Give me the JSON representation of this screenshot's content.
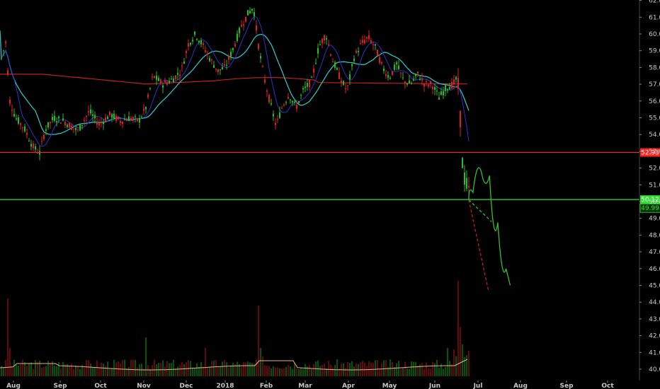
{
  "chart_data": {
    "type": "candlestick",
    "price_axis": {
      "ylim": [
        39.5,
        62.2
      ],
      "ticks": [
        "40.00",
        "41.00",
        "42.00",
        "43.00",
        "44.00",
        "45.00",
        "46.00",
        "47.00",
        "48.00",
        "49.00",
        "50.00",
        "51.00",
        "52.00",
        "53.00",
        "54.00",
        "55.00",
        "56.00",
        "57.00",
        "58.00",
        "59.00",
        "60.00",
        "61.00",
        "62.00"
      ]
    },
    "x_axis": {
      "labels": [
        "Aug",
        "Sep",
        "Oct",
        "Nov",
        "Dec",
        "2018",
        "Feb",
        "Mar",
        "Apr",
        "May",
        "Jun",
        "Jul",
        "Aug",
        "Sep",
        "Oct"
      ],
      "bold_labels": [
        "2018"
      ]
    },
    "horizontal_levels": [
      {
        "value": 52.93,
        "label": "52.93",
        "color": "#ff2020"
      },
      {
        "value": 50.12,
        "label": "50.12",
        "color": "#30e030"
      }
    ],
    "last_price": {
      "label": "49.99",
      "color": "#30e030"
    },
    "moving_averages": [
      {
        "color": "#2fbfbf",
        "period": "medium"
      },
      {
        "color": "#3030c8",
        "period": "short"
      },
      {
        "color": "#c02020",
        "period": "long"
      }
    ],
    "projections": [
      {
        "style": "solid",
        "color": "#30c030",
        "points": [
          [
            0,
            50.1
          ],
          [
            6,
            51.0
          ],
          [
            12,
            52.6
          ],
          [
            18,
            50.5
          ],
          [
            24,
            47.0
          ],
          [
            30,
            45.0
          ]
        ]
      },
      {
        "style": "dashed",
        "color": "#30c030",
        "points": [
          [
            0,
            50.1
          ],
          [
            14,
            48.8
          ]
        ]
      },
      {
        "style": "dashed",
        "color": "#c02020",
        "points": [
          [
            0,
            50.1
          ],
          [
            12,
            44.7
          ]
        ]
      }
    ],
    "volume": {
      "shown": true,
      "scale_max": 1.0
    }
  }
}
